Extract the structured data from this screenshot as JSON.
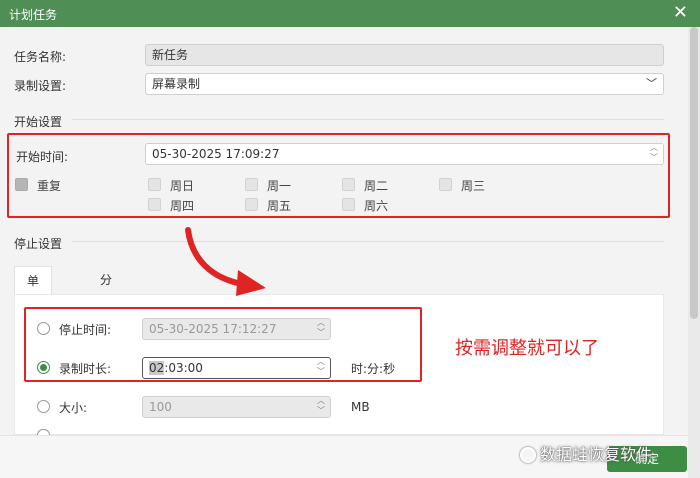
{
  "window": {
    "title": "计划任务"
  },
  "task": {
    "name_label": "任务名称:",
    "name_value": "新任务",
    "record_label": "录制设置:",
    "record_value": "屏幕录制"
  },
  "start": {
    "section": "开始设置",
    "time_label": "开始时间:",
    "time_value": "05-30-2025 17:09:27",
    "repeat_label": "重复",
    "days": [
      "周日",
      "周一",
      "周二",
      "周三",
      "周四",
      "周五",
      "周六"
    ]
  },
  "stop": {
    "section": "停止设置",
    "tabs": [
      "单段录制",
      "分段录制"
    ],
    "stop_time_label": "停止时间:",
    "stop_time_value": "05-30-2025 17:12:27",
    "duration_label": "录制时长:",
    "duration_hl": "02",
    "duration_rest": ":03:00",
    "duration_unit": "时:分:秒",
    "size_label": "大小:",
    "size_value": "100",
    "size_unit": "MB"
  },
  "annotation": "按需调整就可以了",
  "footer": {
    "ok": "确定",
    "watermark": "数据蛙恢复软件"
  },
  "colors": {
    "titlebar": "#4f8f55",
    "accent": "#3e8d45",
    "annotation_red": "#e02424"
  }
}
